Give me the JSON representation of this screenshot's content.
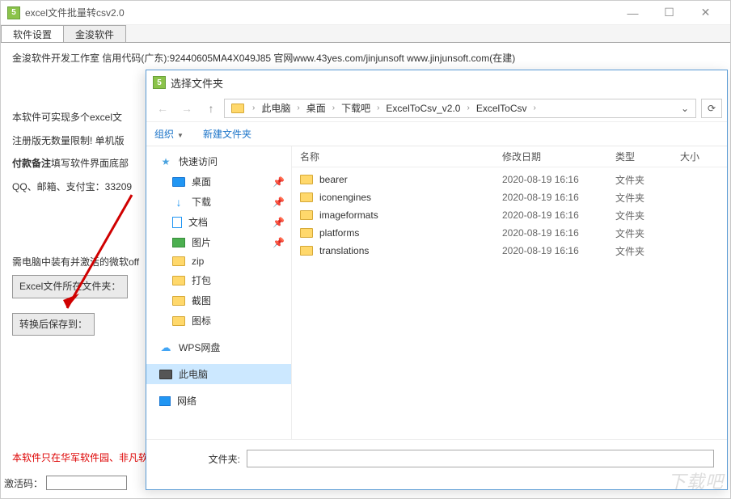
{
  "main": {
    "title": "excel文件批量转csv2.0",
    "tabs": [
      "软件设置",
      "金浚软件"
    ],
    "credit": "金浚软件开发工作室 信用代码(广东):92440605MA4X049J85 官网www.43yes.com/jinjunsoft  www.jinjunsoft.com(在建)",
    "desc1": "本软件可实现多个excel文",
    "desc2": "注册版无数量限制! 单机版",
    "desc3_a": "付款备注",
    "desc3_b": "填写软件界面底部",
    "desc4": "QQ、邮箱、支付宝：33209",
    "need": "需电脑中装有并激活的微软off",
    "btn_source": "Excel文件所在文件夹：",
    "btn_save": "转换后保存到：",
    "bottom_notice": "本软件只在华军软件园、非凡软",
    "activation_label": "激活码："
  },
  "dialog": {
    "title": "选择文件夹",
    "breadcrumb": [
      "此电脑",
      "桌面",
      "下载吧",
      "ExcelToCsv_v2.0",
      "ExcelToCsv"
    ],
    "toolbar2": {
      "organize": "组织",
      "new_folder": "新建文件夹"
    },
    "tree": {
      "quick": "快速访问",
      "desktop": "桌面",
      "downloads": "下载",
      "documents": "文档",
      "pictures": "图片",
      "zip": "zip",
      "pack": "打包",
      "screenshot": "截图",
      "icons": "图标",
      "wps": "WPS网盘",
      "thispc": "此电脑",
      "network": "网络"
    },
    "columns": {
      "name": "名称",
      "date": "修改日期",
      "type": "类型",
      "size": "大小"
    },
    "files": [
      {
        "name": "bearer",
        "date": "2020-08-19 16:16",
        "type": "文件夹"
      },
      {
        "name": "iconengines",
        "date": "2020-08-19 16:16",
        "type": "文件夹"
      },
      {
        "name": "imageformats",
        "date": "2020-08-19 16:16",
        "type": "文件夹"
      },
      {
        "name": "platforms",
        "date": "2020-08-19 16:16",
        "type": "文件夹"
      },
      {
        "name": "translations",
        "date": "2020-08-19 16:16",
        "type": "文件夹"
      }
    ],
    "footer_label": "文件夹:"
  },
  "watermark": "下载吧"
}
